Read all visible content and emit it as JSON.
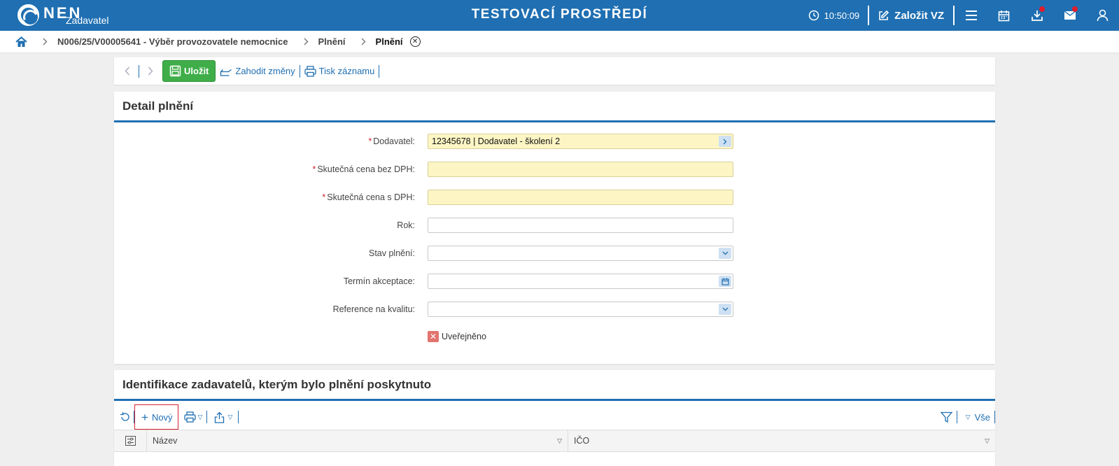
{
  "header": {
    "logo_text": "NEN",
    "logo_sub": "Zadavatel",
    "env_title": "TESTOVACÍ PROSTŘEDÍ",
    "time": "10:50:09",
    "create_label": "Založit VZ",
    "icons": [
      "menu-icon",
      "calendar-icon",
      "download-icon",
      "mail-icon",
      "user-icon"
    ],
    "accent": "#1f6fb2",
    "badge_color": "#e11d2b"
  },
  "breadcrumb": {
    "items": [
      "N006/25/V00005641 - Výběr provozovatele nemocnice",
      "Plnění",
      "Plnění"
    ]
  },
  "toolbar": {
    "save_label": "Uložit",
    "discard_label": "Zahodit změny",
    "print_label": "Tisk záznamu"
  },
  "detail": {
    "title": "Detail plnění",
    "fields": {
      "supplier": {
        "label": "Dodavatel:",
        "value": "12345678 | Dodavatel - školení 2"
      },
      "price_no_vat": {
        "label": "Skutečná cena bez DPH:",
        "value": ""
      },
      "price_vat": {
        "label": "Skutečná cena s DPH:",
        "value": ""
      },
      "year": {
        "label": "Rok:",
        "value": ""
      },
      "status": {
        "label": "Stav plnění:",
        "value": ""
      },
      "acceptance": {
        "label": "Termín akceptace:",
        "value": ""
      },
      "quality_ref": {
        "label": "Reference na kvalitu:",
        "value": ""
      }
    },
    "published_label": "Uveřejněno"
  },
  "table": {
    "title": "Identifikace zadavatelů, kterým bylo plnění poskytnuto",
    "new_label": "Nový",
    "all_label": "Vše",
    "columns": [
      "Název",
      "IČO"
    ]
  }
}
